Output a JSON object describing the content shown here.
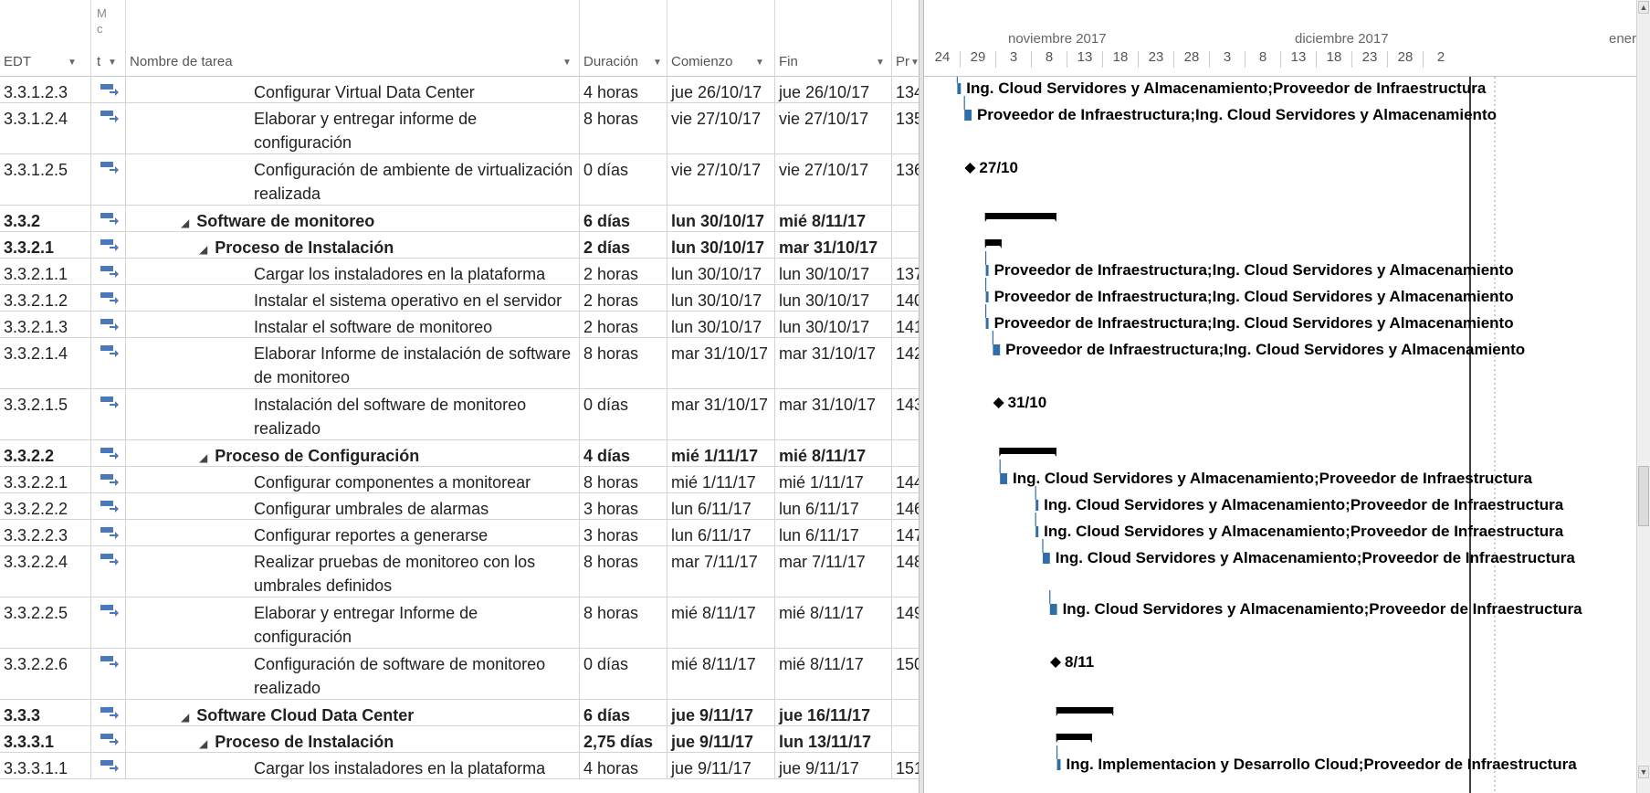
{
  "columns": {
    "edt": "EDT",
    "mode_letters": [
      "M",
      "c",
      "t"
    ],
    "name": "Nombre de tarea",
    "duration": "Duración",
    "start": "Comienzo",
    "finish": "Fin",
    "pred": "Pr"
  },
  "timescale": {
    "months": [
      "noviembre 2017",
      "diciembre 2017",
      "enero"
    ],
    "ticks": [
      "24",
      "29",
      "3",
      "8",
      "13",
      "18",
      "23",
      "28",
      "3",
      "8",
      "13",
      "18",
      "23",
      "28",
      "2"
    ]
  },
  "rows": [
    {
      "edt": "3.3.1.2.3",
      "indent": 3,
      "summary": false,
      "name": "Configurar Virtual Data Center",
      "dur": "4 horas",
      "start": "jue 26/10/17",
      "finish": "jue 26/10/17",
      "pred": "134",
      "gantt": "Ing. Cloud Servidores y Almacenamiento;Proveedor de Infraestructura"
    },
    {
      "edt": "3.3.1.2.4",
      "indent": 3,
      "summary": false,
      "name": "Elaborar y entregar informe de configuración",
      "dur": "8 horas",
      "start": "vie 27/10/17",
      "finish": "vie 27/10/17",
      "pred": "135",
      "gantt": "Proveedor de Infraestructura;Ing. Cloud Servidores y Almacenamiento"
    },
    {
      "edt": "3.3.1.2.5",
      "indent": 3,
      "summary": false,
      "name": "Configuración de ambiente de virtualización realizada",
      "dur": "0 días",
      "start": "vie 27/10/17",
      "finish": "vie 27/10/17",
      "pred": "136",
      "gantt": "27/10"
    },
    {
      "edt": "3.3.2",
      "indent": 1,
      "summary": true,
      "name": "Software de monitoreo",
      "dur": "6 días",
      "start": "lun 30/10/17",
      "finish": "mié 8/11/17",
      "pred": "",
      "gantt": ""
    },
    {
      "edt": "3.3.2.1",
      "indent": 2,
      "summary": true,
      "name": "Proceso de Instalación",
      "dur": "2 días",
      "start": "lun 30/10/17",
      "finish": "mar 31/10/17",
      "pred": "",
      "gantt": ""
    },
    {
      "edt": "3.3.2.1.1",
      "indent": 3,
      "summary": false,
      "name": "Cargar los instaladores en la plataforma",
      "dur": "2 horas",
      "start": "lun 30/10/17",
      "finish": "lun 30/10/17",
      "pred": "137",
      "gantt": "Proveedor de Infraestructura;Ing. Cloud Servidores y Almacenamiento"
    },
    {
      "edt": "3.3.2.1.2",
      "indent": 3,
      "summary": false,
      "name": "Instalar el sistema operativo en el servidor",
      "dur": "2 horas",
      "start": "lun 30/10/17",
      "finish": "lun 30/10/17",
      "pred": "140",
      "gantt": "Proveedor de Infraestructura;Ing. Cloud Servidores y Almacenamiento"
    },
    {
      "edt": "3.3.2.1.3",
      "indent": 3,
      "summary": false,
      "name": "Instalar el software de monitoreo",
      "dur": "2 horas",
      "start": "lun 30/10/17",
      "finish": "lun 30/10/17",
      "pred": "141",
      "gantt": "Proveedor de Infraestructura;Ing. Cloud Servidores y Almacenamiento"
    },
    {
      "edt": "3.3.2.1.4",
      "indent": 3,
      "summary": false,
      "name": "Elaborar Informe de instalación de software de monitoreo",
      "dur": "8 horas",
      "start": "mar 31/10/17",
      "finish": "mar 31/10/17",
      "pred": "142",
      "gantt": "Proveedor de Infraestructura;Ing. Cloud Servidores y Almacenamiento"
    },
    {
      "edt": "3.3.2.1.5",
      "indent": 3,
      "summary": false,
      "name": "Instalación del software de monitoreo realizado",
      "dur": "0 días",
      "start": "mar 31/10/17",
      "finish": "mar 31/10/17",
      "pred": "143",
      "gantt": "31/10"
    },
    {
      "edt": "3.3.2.2",
      "indent": 2,
      "summary": true,
      "name": "Proceso de Configuración",
      "dur": "4 días",
      "start": "mié 1/11/17",
      "finish": "mié 8/11/17",
      "pred": "",
      "gantt": ""
    },
    {
      "edt": "3.3.2.2.1",
      "indent": 3,
      "summary": false,
      "name": "Configurar componentes a monitorear",
      "dur": "8 horas",
      "start": "mié 1/11/17",
      "finish": "mié 1/11/17",
      "pred": "144",
      "gantt": "Ing. Cloud Servidores y Almacenamiento;Proveedor de Infraestructura"
    },
    {
      "edt": "3.3.2.2.2",
      "indent": 3,
      "summary": false,
      "name": "Configurar umbrales de alarmas",
      "dur": "3 horas",
      "start": "lun 6/11/17",
      "finish": "lun 6/11/17",
      "pred": "146",
      "gantt": "Ing. Cloud Servidores y Almacenamiento;Proveedor de Infraestructura"
    },
    {
      "edt": "3.3.2.2.3",
      "indent": 3,
      "summary": false,
      "name": "Configurar reportes a generarse",
      "dur": "3 horas",
      "start": "lun 6/11/17",
      "finish": "lun 6/11/17",
      "pred": "147",
      "gantt": "Ing. Cloud Servidores y Almacenamiento;Proveedor de Infraestructura"
    },
    {
      "edt": "3.3.2.2.4",
      "indent": 3,
      "summary": false,
      "name": "Realizar pruebas de monitoreo con los umbrales definidos",
      "dur": "8 horas",
      "start": "mar 7/11/17",
      "finish": "mar 7/11/17",
      "pred": "148",
      "gantt": "Ing. Cloud Servidores y Almacenamiento;Proveedor de Infraestructura"
    },
    {
      "edt": "3.3.2.2.5",
      "indent": 3,
      "summary": false,
      "name": "Elaborar y entregar Informe de configuración",
      "dur": "8 horas",
      "start": "mié 8/11/17",
      "finish": "mié 8/11/17",
      "pred": "149",
      "gantt": "Ing. Cloud Servidores y Almacenamiento;Proveedor de Infraestructura"
    },
    {
      "edt": "3.3.2.2.6",
      "indent": 3,
      "summary": false,
      "name": "Configuración de software de monitoreo realizado",
      "dur": "0 días",
      "start": "mié 8/11/17",
      "finish": "mié 8/11/17",
      "pred": "150",
      "gantt": "8/11"
    },
    {
      "edt": "3.3.3",
      "indent": 1,
      "summary": true,
      "name": "Software Cloud Data Center",
      "dur": "6 días",
      "start": "jue 9/11/17",
      "finish": "jue 16/11/17",
      "pred": "",
      "gantt": ""
    },
    {
      "edt": "3.3.3.1",
      "indent": 2,
      "summary": true,
      "name": "Proceso de Instalación",
      "dur": "2,75 días",
      "start": "jue 9/11/17",
      "finish": "lun 13/11/17",
      "pred": "",
      "gantt": ""
    },
    {
      "edt": "3.3.3.1.1",
      "indent": 3,
      "summary": false,
      "name": "Cargar los instaladores en la plataforma",
      "dur": "4 horas",
      "start": "jue 9/11/17",
      "finish": "jue 9/11/17",
      "pred": "151",
      "gantt": "Ing. Implementacion y Desarrollo Cloud;Proveedor de Infraestructura"
    }
  ],
  "colors": {
    "task_bar": "#2f6ea8",
    "summary_bar": "#000000",
    "link": "#2f6ea8",
    "mode_icon": "#4a78b8"
  }
}
